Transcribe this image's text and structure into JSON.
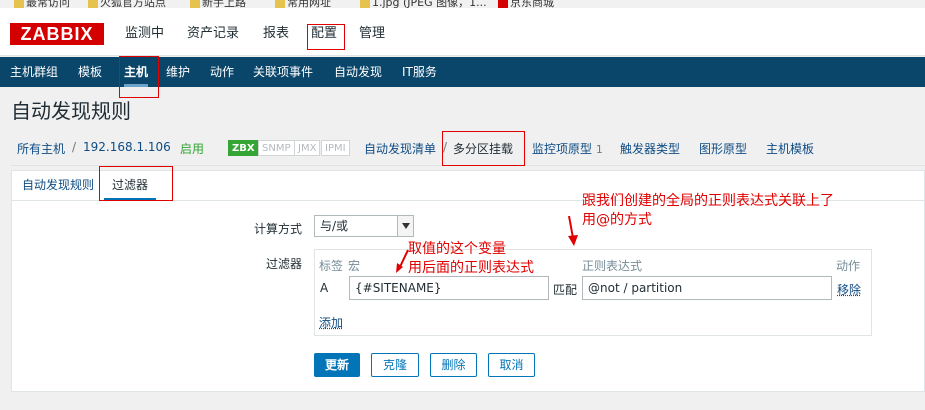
{
  "bookmarks": [
    {
      "label": "最常访问"
    },
    {
      "label": "火狐官方站点"
    },
    {
      "label": "新手上路"
    },
    {
      "label": "常用网址"
    },
    {
      "label": "1.jpg (JPEG 图像，1..."
    },
    {
      "label": "京东商城"
    }
  ],
  "header": {
    "logo": "ZABBIX",
    "menu": [
      {
        "label": "监测中"
      },
      {
        "label": "资产记录"
      },
      {
        "label": "报表"
      },
      {
        "label": "配置"
      },
      {
        "label": "管理"
      }
    ]
  },
  "submenu": [
    {
      "label": "主机群组"
    },
    {
      "label": "模板"
    },
    {
      "label": "主机"
    },
    {
      "label": "维护"
    },
    {
      "label": "动作"
    },
    {
      "label": "关联项事件"
    },
    {
      "label": "自动发现"
    },
    {
      "label": "IT服务"
    }
  ],
  "page": {
    "title": "自动发现规则"
  },
  "hostnav": {
    "all_hosts": "所有主机",
    "separator": "/",
    "host": "192.168.1.106",
    "status": "启用",
    "badges": [
      "ZBX",
      "SNMP",
      "JMX",
      "IPMI"
    ],
    "discovery_list": "自动发现清单",
    "rule": "多分区挂载",
    "item_prototypes": "监控项原型",
    "item_prototypes_count": "1",
    "trigger_types": "触发器类型",
    "graph_prototypes": "图形原型",
    "host_templates": "主机模板"
  },
  "tabs": [
    {
      "label": "自动发现规则"
    },
    {
      "label": "过滤器"
    }
  ],
  "form": {
    "calc_label": "计算方式",
    "calc_value": "与/或",
    "filter_label": "过滤器",
    "headers": {
      "label": "标签",
      "macro": "宏",
      "regex": "正则表达式",
      "action": "动作"
    },
    "row": {
      "label": "A",
      "macro": "{#SITENAME}",
      "match": "匹配",
      "regex": "@not / partition",
      "remove": "移除"
    },
    "add": "添加"
  },
  "buttons": {
    "update": "更新",
    "clone": "克隆",
    "delete": "删除",
    "cancel": "取消"
  },
  "annotations": {
    "a1_line1": "取值的这个变量",
    "a1_line2": "用后面的正则表达式",
    "a2_line1": "跟我们创建的全局的正则表达式关联上了",
    "a2_line2": "用@的方式"
  },
  "colors": {
    "brand": "#d40000",
    "nav": "#0a466a",
    "link": "#0f4c84",
    "primary": "#0275b8",
    "enabled": "#35a535",
    "annotation": "#e00000"
  }
}
